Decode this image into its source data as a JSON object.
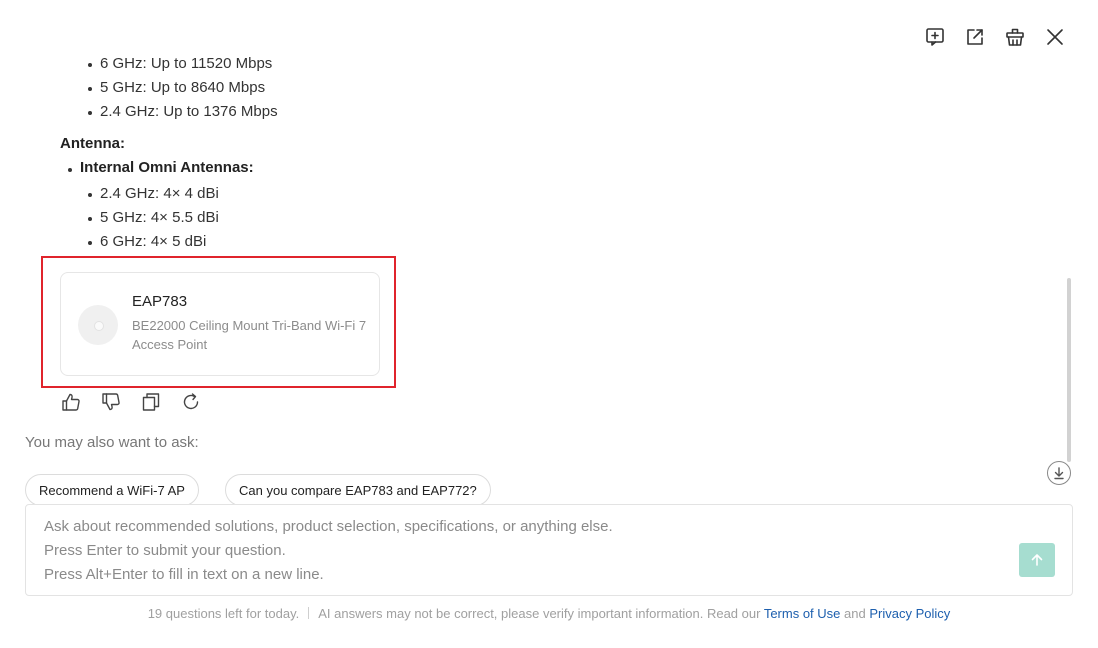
{
  "window": {
    "icons": [
      "add-note-icon",
      "external-link-icon",
      "clear-history-icon",
      "close-icon"
    ]
  },
  "speeds": [
    {
      "text": "6 GHz: Up to 11520 Mbps"
    },
    {
      "text": "5 GHz: Up to 8640 Mbps"
    },
    {
      "text": "2.4 GHz: Up to 1376 Mbps"
    }
  ],
  "antenna": {
    "title": "Antenna:",
    "subtitle": "Internal Omni Antennas:",
    "items": [
      {
        "text": "2.4 GHz: 4× 4 dBi"
      },
      {
        "text": "5 GHz: 4× 5.5 dBi"
      },
      {
        "text": "6 GHz: 4× 5 dBi"
      }
    ]
  },
  "product": {
    "name": "EAP783",
    "description": "BE22000 Ceiling Mount Tri-Band Wi-Fi 7 Access Point"
  },
  "feedback_icons": [
    "thumbs-up-icon",
    "thumbs-down-icon",
    "copy-icon",
    "regenerate-icon"
  ],
  "suggestions": {
    "title": "You may also want to ask:",
    "items": [
      "Recommend a WiFi-7 AP",
      "Can you compare EAP783 and EAP772?"
    ]
  },
  "input": {
    "value": "",
    "placeholder": "Ask about recommended solutions, product selection, specifications, or anything else.\nPress Enter to submit your question.\nPress Alt+Enter to fill in text on a new line."
  },
  "footer": {
    "quota": "19 questions left for today.",
    "disclaimer": "AI answers may not be correct, please verify important information. Read our",
    "terms": "Terms of Use",
    "and": "and",
    "privacy": "Privacy Policy"
  },
  "colors": {
    "highlight": "#e0242c",
    "send_button": "#a6ddd0",
    "link": "#1d5fae"
  }
}
